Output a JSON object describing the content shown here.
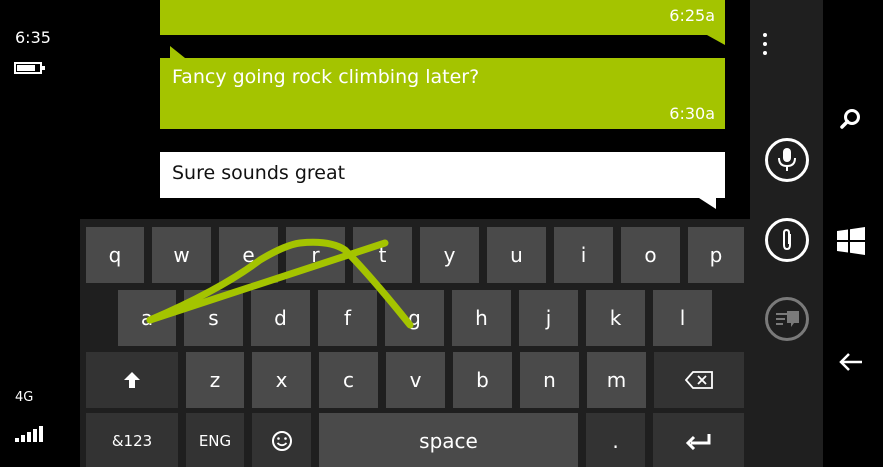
{
  "status": {
    "time": "6:35",
    "network": "4G"
  },
  "conversation": {
    "previous_time": "6:25a",
    "message_text": "Fancy going rock climbing later?",
    "message_time": "6:30a",
    "compose_value": "Sure sounds great"
  },
  "keyboard": {
    "row1": [
      "q",
      "w",
      "e",
      "r",
      "t",
      "y",
      "u",
      "i",
      "o",
      "p"
    ],
    "row2": [
      "a",
      "s",
      "d",
      "f",
      "g",
      "h",
      "j",
      "k",
      "l"
    ],
    "row3": [
      "z",
      "x",
      "c",
      "v",
      "b",
      "n",
      "m"
    ],
    "symbols_label": "&123",
    "language_label": "ENG",
    "space_label": "space",
    "period_label": "."
  },
  "icons": {
    "shift": "shift-arrow-icon",
    "backspace": "backspace-icon",
    "emoji": "emoji-icon",
    "enter": "enter-icon",
    "microphone": "microphone-icon",
    "attach": "paperclip-icon",
    "send": "send-message-icon",
    "search": "search-icon",
    "start": "windows-start-icon",
    "back": "back-arrow-icon",
    "more": "more-ellipsis-icon"
  },
  "colors": {
    "accent": "#a4c400",
    "key": "#4a4a4a",
    "key_func": "#333333",
    "appbar": "#1f1f1f"
  }
}
